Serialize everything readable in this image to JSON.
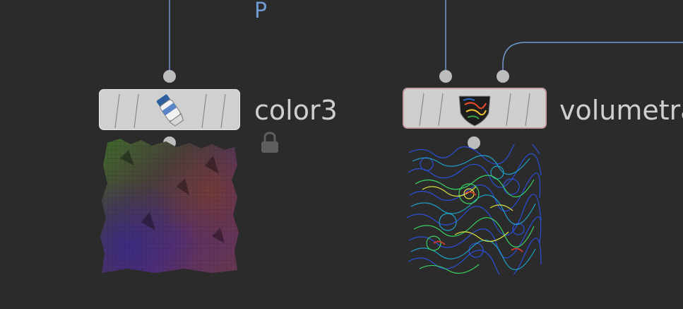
{
  "network_label": "P",
  "nodes": [
    {
      "name": "color3",
      "icon": "paint-tube-icon",
      "locked": true
    },
    {
      "name": "volumetra",
      "icon": "volume-trail-shield-icon",
      "locked": false
    }
  ],
  "colors": {
    "background": "#2b2b2b",
    "wire": "#6f9bd1",
    "node_body": "#d0d0d0",
    "selected_outline": "#c99fa4",
    "port": "#bdbdbd",
    "label": "#cfcfcf"
  }
}
